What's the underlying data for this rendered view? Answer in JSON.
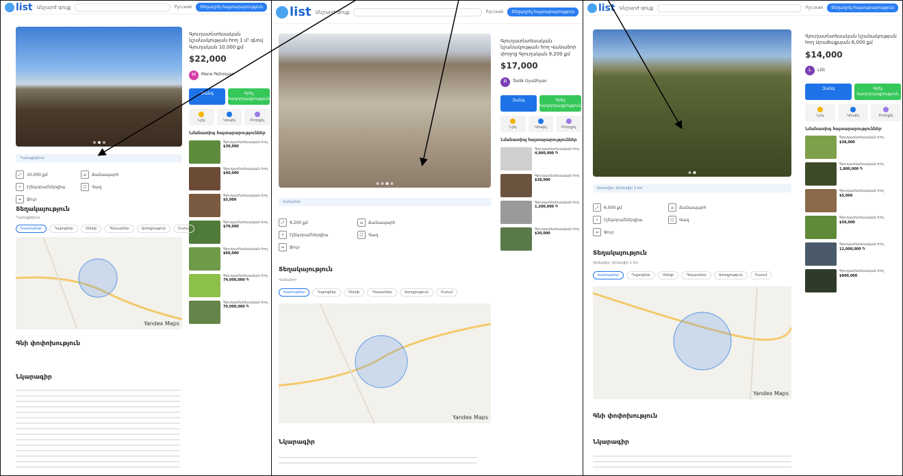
{
  "header": {
    "logo": "list",
    "category": "Անշարժ գույք",
    "lang": "Русский",
    "post": "Տեղադրել հայտարարություն"
  },
  "listings": [
    {
      "title": "Գյուղատնտեսական նշանակության հող 1 մ² գնով Գյուղական 10,000 քմ",
      "price": "$22,000",
      "seller": "Mane Petrosyan",
      "seller_initial": "M",
      "avatar_color": "#d63ba5",
      "location": "Ղարաքիլիսա",
      "attrs": [
        "10,000 քմ",
        "Ճանապարհ",
        "Էլեկտրաէներգիա",
        "Գազ",
        "Ջուր"
      ],
      "loc_heading": "Տեղակայություն",
      "price_history_heading": "Գնի փոփոխություն",
      "description_heading": "Նկարագիր",
      "similar": [
        {
          "text": "Գյուղատնտեսական հող",
          "price": "$30,000"
        },
        {
          "text": "Գյուղատնտեսական հող",
          "price": "$40,000"
        },
        {
          "text": "Գյուղատնտեսական հող",
          "price": "$5,000"
        },
        {
          "text": "Գյուղատնտեսական հող",
          "price": "$70,000"
        },
        {
          "text": "Գյուղատնտեսական հող",
          "price": "$60,000"
        },
        {
          "text": "Գյուղատնտեսական հող",
          "price": "74,000,000 ֏"
        },
        {
          "text": "Գյուղատնտեսական հող",
          "price": "70,000,000 ֏"
        }
      ]
    },
    {
      "title": "Գյուղատնտեսական նշանակության հող Վանաձոր փողոց Գյուղական 9,200 քմ",
      "price": "$17,000",
      "seller": "Tsolik Gyulzhyan",
      "seller_initial": "R",
      "avatar_color": "#7b3fb5",
      "location": "Վանաձոր",
      "attrs": [
        "9,200 քմ",
        "Ճանապարհ",
        "Էլեկտրաէներգիա",
        "Գազ",
        "Ջուր"
      ],
      "loc_heading": "Տեղակայություն",
      "description_heading": "Նկարագիր",
      "similar": [
        {
          "text": "Գյուղատնտեսական հող",
          "price": "4,000,000 ֏"
        },
        {
          "text": "Գյուղատնտեսական հող",
          "price": "$28,000"
        },
        {
          "text": "Գյուղատնտեսական հող",
          "price": "1,200,000 ֏"
        },
        {
          "text": "Գյուղատնտեսական հող",
          "price": "$30,000"
        }
      ]
    },
    {
      "title": "Գյուղատնտեսական նշանակության հող Արածաքսյան 6,000 քմ",
      "price": "$14,000",
      "seller": "Lilit",
      "seller_initial": "L",
      "avatar_color": "#7b3fb5",
      "location": "Արմավիր, Արմավիր 1 km",
      "attrs": [
        "6,000 քմ",
        "Ճանապարհ",
        "Էլեկտրաէներգիա",
        "Գազ",
        "Ջուր"
      ],
      "loc_heading": "Տեղակայություն",
      "price_history_heading": "Գնի փոփոխություն",
      "description_heading": "Նկարագիր",
      "similar": [
        {
          "text": "Գյուղատնտեսական հող",
          "price": "$38,000"
        },
        {
          "text": "Գյուղատնտեսական հող",
          "price": "1,800,000 ֏"
        },
        {
          "text": "Գյուղատնտեսական հող",
          "price": "$5,000"
        },
        {
          "text": "Գյուղատնտեսական հող",
          "price": "$50,000"
        },
        {
          "text": "Գյուղատնտեսական հող",
          "price": "12,000,000 ֏"
        },
        {
          "text": "Գյուղատնտեսական հող",
          "price": "$800,000"
        }
      ]
    }
  ],
  "chips": [
    "Խանութներ",
    "Դպրոցներ",
    "Սննդի",
    "Դեղատներ",
    "Առողջություն",
    "Ուսում"
  ],
  "side_buttons": {
    "call": "Զանգ",
    "message": "Գրել հաղորդագրություն"
  },
  "side_actions": [
    "Նշել",
    "Կիսվել",
    "Բողոքել"
  ],
  "similar_heading": "Նմանատիպ հայտարարություններ",
  "map_brand": "Yandex Maps",
  "colors": {
    "accent": "#1e73e8",
    "green": "#35c759"
  }
}
